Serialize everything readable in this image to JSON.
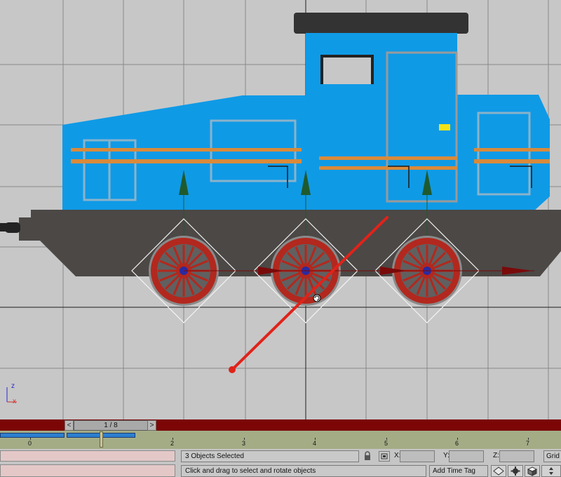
{
  "viewport": {
    "axis_labels": {
      "z": "z",
      "x": "x"
    }
  },
  "timeslider": {
    "prev_label": "<",
    "next_label": ">",
    "frame_readout": "1 / 8"
  },
  "trackbar": {
    "ticks": [
      "0",
      "2",
      "3",
      "4",
      "5",
      "6",
      "7"
    ]
  },
  "status": {
    "selection": "3 Objects Selected",
    "prompt": "Click and drag to select and rotate objects",
    "coord_labels": {
      "x": "X:",
      "y": "Y:",
      "z": "Z:"
    },
    "coord_values": {
      "x": "",
      "y": "",
      "z": ""
    },
    "add_time_tag": "Add Time Tag",
    "grid_label": "Grid ="
  },
  "icons": {
    "lock": "lock-icon",
    "selection_toggle": "absolute-mode-icon",
    "orbit": "orbit-icon",
    "gear": "gear-icon",
    "cube": "cube-icon",
    "navigate": "pan-icon"
  },
  "colors": {
    "viewport_bg": "#c7c7c7",
    "loco_body": "#0f9ae6",
    "chassis": "#4b4846",
    "wheel": "#b2281e",
    "timeline": "#7c0606",
    "trackbar": "#a4ac86"
  }
}
